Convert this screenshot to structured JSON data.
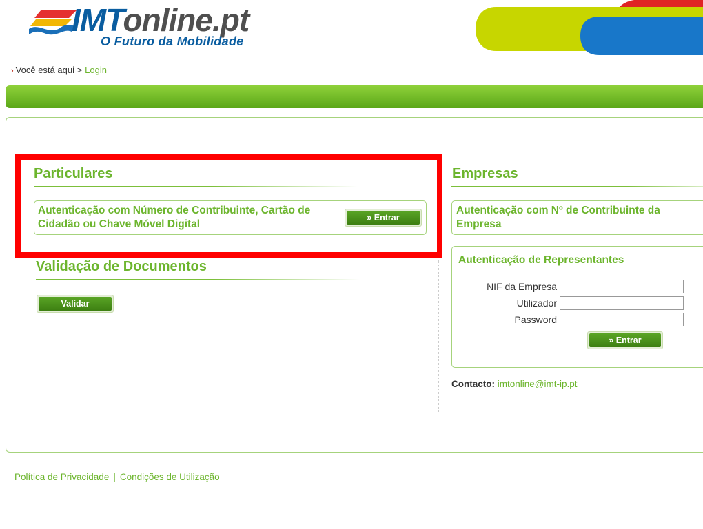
{
  "header": {
    "logo_imt": "IMT",
    "logo_online": "online.pt",
    "tagline": "O Futuro da Mobilidade"
  },
  "breadcrumb": {
    "prefix": "Você está aqui >",
    "current": "Login"
  },
  "particulares": {
    "title": "Particulares",
    "auth_text": "Autenticação com Número de Contribuinte, Cartão de Cidadão ou Chave Móvel Digital",
    "button_label": "» Entrar"
  },
  "validacao": {
    "title": "Validação de Documentos",
    "button_label": "Validar"
  },
  "empresas": {
    "title": "Empresas",
    "auth_text": "Autenticação com Nº de Contribuinte da Empresa",
    "representantes": {
      "title": "Autenticação de Representantes",
      "nif_label": "NIF da Empresa",
      "nif_value": "",
      "user_label": "Utilizador",
      "user_value": "",
      "password_label": "Password",
      "password_value": "",
      "button_label": "» Entrar"
    }
  },
  "contact": {
    "label": "Contacto:",
    "email": "imtonline@imt-ip.pt"
  },
  "footer": {
    "privacy": "Política de Privacidade",
    "separator": "|",
    "terms": "Condições de Utilização"
  },
  "colors": {
    "accent_green": "#6cb52d",
    "brand_blue": "#0a5da0",
    "highlight_red": "#ff0000"
  }
}
